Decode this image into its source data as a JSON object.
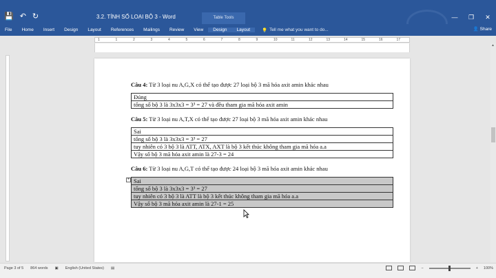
{
  "window": {
    "title": "3.2. TÍNH SỐ LOẠI BỘ 3 - Word",
    "context_tab_header": "Table Tools",
    "controls": [
      "—",
      "❐",
      "✕"
    ],
    "qat": {
      "save": "💾",
      "undo": "↶",
      "redo": "↻"
    }
  },
  "ribbon": {
    "tabs": [
      "File",
      "Home",
      "Insert",
      "Design",
      "Layout",
      "References",
      "Mailings",
      "Review",
      "View"
    ],
    "context_tabs": [
      "Design",
      "Layout"
    ],
    "tellme": "Tell me what you want to do...",
    "share": "Share"
  },
  "ruler": {
    "marks": [
      "1",
      "1",
      "2",
      "3",
      "4",
      "5",
      "6",
      "7",
      "8",
      "9",
      "10",
      "11",
      "12",
      "13",
      "14",
      "15",
      "16",
      "17"
    ]
  },
  "document": {
    "q4": {
      "label": "Câu 4:",
      "text": " Từ 3 loại nu A,G,X có thể tạo được  27 loại bộ 3 mã hóa axit amin khác nhau",
      "answers": [
        "Đúng",
        "tổng số bộ 3 là 3x3x3 = 3³ = 27 và đều tham gia mã hóa axit amin"
      ]
    },
    "q5": {
      "label": "Câu 5:",
      "text": " Từ 3 loại nu A,T,X có thể tạo được  27 loại bộ 3 mã hóa axit amin khác nhau",
      "answers": [
        "Sai",
        "tổng số bộ 3 là 3x3x3 = 3³ = 27",
        "tuy nhiên có 3 bộ 3 là ATT, ATX, AXT là bộ 3 kết thúc không tham gia mã hóa a.a",
        "Vậy số bộ 3 mã hóa axit amin là 27-3 = 24"
      ]
    },
    "q6": {
      "label": "Câu 6:",
      "text": " Từ 3 loại nu A,G,T có thể tạo được  24 loại bộ 3 mã hóa axit amin khác nhau",
      "answers": [
        "Sai",
        "tổng số bộ 3 là 3x3x3 = 3³ = 27",
        "tuy nhiên có 3 bộ 3 là ATT là bộ 3 kết thúc không tham gia mã hóa a.a",
        "Vậy số bộ 3 mã hóa axit amin là 27-1 = 25"
      ]
    }
  },
  "status": {
    "page": "Page 3 of 5",
    "words": "864 words",
    "language": "English (United States)",
    "zoom": "100%"
  }
}
